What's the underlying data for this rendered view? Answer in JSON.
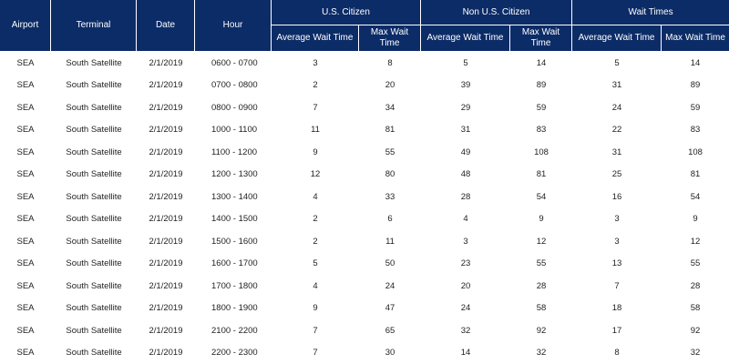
{
  "headers": {
    "airport": "Airport",
    "terminal": "Terminal",
    "date": "Date",
    "hour": "Hour",
    "groups": [
      {
        "label": "U.S. Citizen",
        "avg": "Average Wait Time",
        "max": "Max Wait Time"
      },
      {
        "label": "Non U.S. Citizen",
        "avg": "Average Wait Time",
        "max": "Max Wait Time"
      },
      {
        "label": "Wait Times",
        "avg": "Average Wait Time",
        "max": "Max Wait Time"
      }
    ]
  },
  "rows": [
    {
      "airport": "SEA",
      "terminal": "South Satellite",
      "date": "2/1/2019",
      "hour": "0600 - 0700",
      "us_avg": "3",
      "us_max": "8",
      "non_avg": "5",
      "non_max": "14",
      "all_avg": "5",
      "all_max": "14"
    },
    {
      "airport": "SEA",
      "terminal": "South Satellite",
      "date": "2/1/2019",
      "hour": "0700 - 0800",
      "us_avg": "2",
      "us_max": "20",
      "non_avg": "39",
      "non_max": "89",
      "all_avg": "31",
      "all_max": "89"
    },
    {
      "airport": "SEA",
      "terminal": "South Satellite",
      "date": "2/1/2019",
      "hour": "0800 - 0900",
      "us_avg": "7",
      "us_max": "34",
      "non_avg": "29",
      "non_max": "59",
      "all_avg": "24",
      "all_max": "59"
    },
    {
      "airport": "SEA",
      "terminal": "South Satellite",
      "date": "2/1/2019",
      "hour": "1000 - 1100",
      "us_avg": "11",
      "us_max": "81",
      "non_avg": "31",
      "non_max": "83",
      "all_avg": "22",
      "all_max": "83"
    },
    {
      "airport": "SEA",
      "terminal": "South Satellite",
      "date": "2/1/2019",
      "hour": "1100 - 1200",
      "us_avg": "9",
      "us_max": "55",
      "non_avg": "49",
      "non_max": "108",
      "all_avg": "31",
      "all_max": "108"
    },
    {
      "airport": "SEA",
      "terminal": "South Satellite",
      "date": "2/1/2019",
      "hour": "1200 - 1300",
      "us_avg": "12",
      "us_max": "80",
      "non_avg": "48",
      "non_max": "81",
      "all_avg": "25",
      "all_max": "81"
    },
    {
      "airport": "SEA",
      "terminal": "South Satellite",
      "date": "2/1/2019",
      "hour": "1300 - 1400",
      "us_avg": "4",
      "us_max": "33",
      "non_avg": "28",
      "non_max": "54",
      "all_avg": "16",
      "all_max": "54"
    },
    {
      "airport": "SEA",
      "terminal": "South Satellite",
      "date": "2/1/2019",
      "hour": "1400 - 1500",
      "us_avg": "2",
      "us_max": "6",
      "non_avg": "4",
      "non_max": "9",
      "all_avg": "3",
      "all_max": "9"
    },
    {
      "airport": "SEA",
      "terminal": "South Satellite",
      "date": "2/1/2019",
      "hour": "1500 - 1600",
      "us_avg": "2",
      "us_max": "11",
      "non_avg": "3",
      "non_max": "12",
      "all_avg": "3",
      "all_max": "12"
    },
    {
      "airport": "SEA",
      "terminal": "South Satellite",
      "date": "2/1/2019",
      "hour": "1600 - 1700",
      "us_avg": "5",
      "us_max": "50",
      "non_avg": "23",
      "non_max": "55",
      "all_avg": "13",
      "all_max": "55"
    },
    {
      "airport": "SEA",
      "terminal": "South Satellite",
      "date": "2/1/2019",
      "hour": "1700 - 1800",
      "us_avg": "4",
      "us_max": "24",
      "non_avg": "20",
      "non_max": "28",
      "all_avg": "7",
      "all_max": "28"
    },
    {
      "airport": "SEA",
      "terminal": "South Satellite",
      "date": "2/1/2019",
      "hour": "1800 - 1900",
      "us_avg": "9",
      "us_max": "47",
      "non_avg": "24",
      "non_max": "58",
      "all_avg": "18",
      "all_max": "58"
    },
    {
      "airport": "SEA",
      "terminal": "South Satellite",
      "date": "2/1/2019",
      "hour": "2100 - 2200",
      "us_avg": "7",
      "us_max": "65",
      "non_avg": "32",
      "non_max": "92",
      "all_avg": "17",
      "all_max": "92"
    },
    {
      "airport": "SEA",
      "terminal": "South Satellite",
      "date": "2/1/2019",
      "hour": "2200 - 2300",
      "us_avg": "7",
      "us_max": "30",
      "non_avg": "14",
      "non_max": "32",
      "all_avg": "8",
      "all_max": "32"
    }
  ],
  "colors": {
    "header_bg": "#0c2c67",
    "header_text": "#ffffff",
    "body_text": "#1f1f1f"
  }
}
